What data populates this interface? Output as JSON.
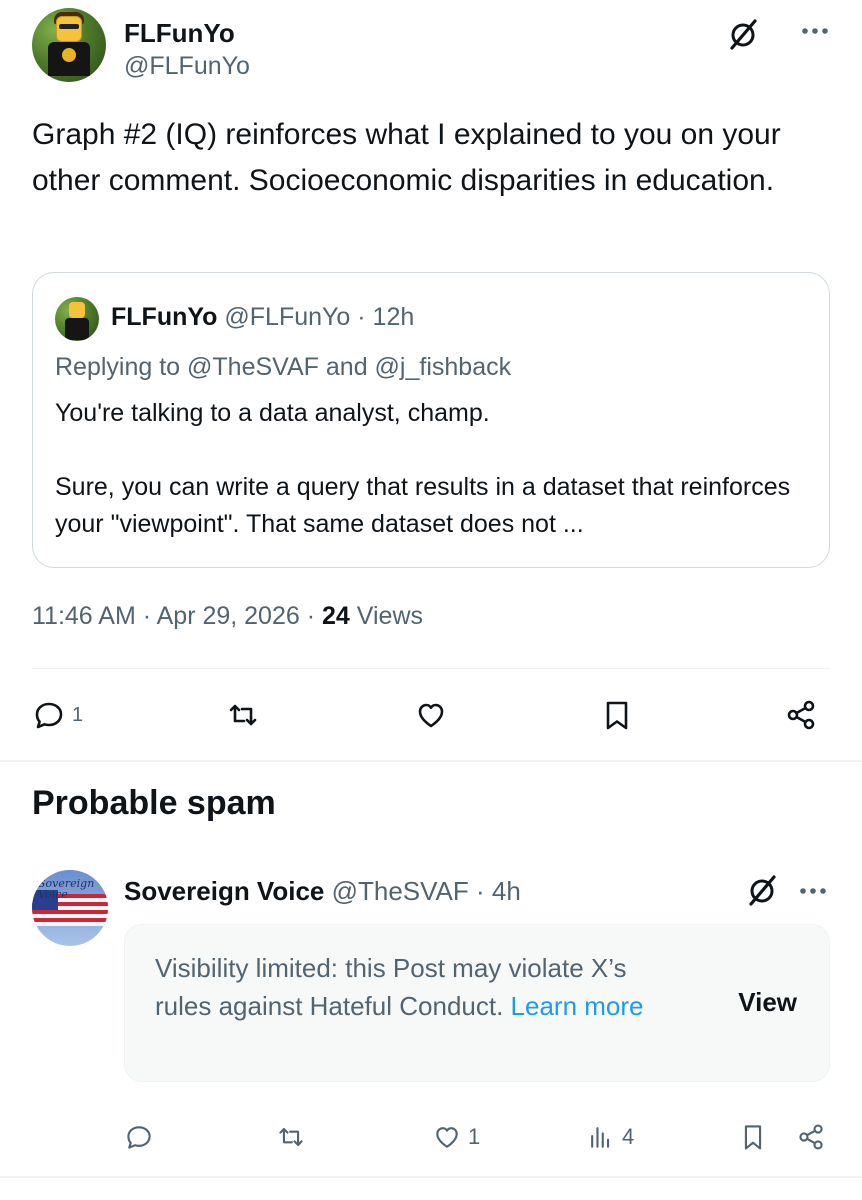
{
  "post": {
    "display_name": "FLFunYo",
    "handle": "@FLFunYo",
    "text": "Graph #2 (IQ) reinforces what I explained to you on your other comment. Socioeconomic disparities in education.",
    "quote": {
      "display_name": "FLFunYo",
      "handle_time": "@FLFunYo · 12h",
      "replying_prefix": "Replying to ",
      "replying_user1": "@TheSVAF",
      "replying_and": " and ",
      "replying_user2": "@j_fishback",
      "paragraph1": "You're talking to a data analyst, champ.",
      "paragraph2": "Sure, you can write a query that results in a dataset that reinforces your \"viewpoint\". That same dataset does not ..."
    },
    "timestamp": "11:46 AM · Apr 29, 2026 · ",
    "views_count": "24",
    "views_label": " Views",
    "actions": {
      "reply_count": "1"
    }
  },
  "section_title": "Probable spam",
  "reply": {
    "display_name": "Sovereign Voice",
    "handle_time": " @TheSVAF · 4h",
    "avatar_text": "Sovereign Voice",
    "limited_text": "Visibility limited: this Post may violate X’s rules against Hateful Conduct. ",
    "learn_more": "Learn more",
    "view_label": "View",
    "actions": {
      "like_count": "1",
      "views_count": "4"
    }
  },
  "colors": {
    "text_primary": "#0f1419",
    "text_secondary": "#536471",
    "link": "#1d9bf0",
    "border": "#cfd9de"
  },
  "icons": {
    "grok": "grok-icon",
    "more": "more-icon",
    "reply": "reply-icon",
    "repost": "repost-icon",
    "like": "heart-icon",
    "bookmark": "bookmark-icon",
    "share": "share-icon",
    "analytics": "analytics-icon"
  }
}
